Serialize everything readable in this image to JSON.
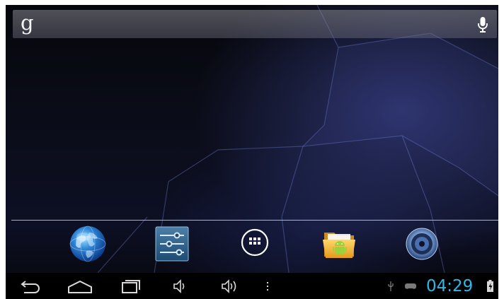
{
  "search": {
    "logo_text": "g",
    "logo_icon": "google-g-icon",
    "mic_icon": "microphone-icon"
  },
  "dock": {
    "items": [
      {
        "name": "browser",
        "icon": "globe-icon"
      },
      {
        "name": "settings",
        "icon": "settings-sliders-icon"
      },
      {
        "name": "all-apps",
        "icon": "app-drawer-icon"
      },
      {
        "name": "file-manager",
        "icon": "android-folder-icon"
      },
      {
        "name": "music",
        "icon": "speaker-icon"
      }
    ]
  },
  "nav_bar": {
    "buttons": [
      "back-icon",
      "home-icon",
      "recent-apps-icon",
      "volume-down-icon",
      "volume-up-icon",
      "menu-icon"
    ],
    "status": {
      "clock": "04:29",
      "clock_color": "#33b5e5",
      "indicators": [
        "usb-icon",
        "gamepad-icon",
        "battery-charging-icon"
      ]
    }
  },
  "colors": {
    "accent": "#33b5e5",
    "nav_background": "#000000"
  }
}
